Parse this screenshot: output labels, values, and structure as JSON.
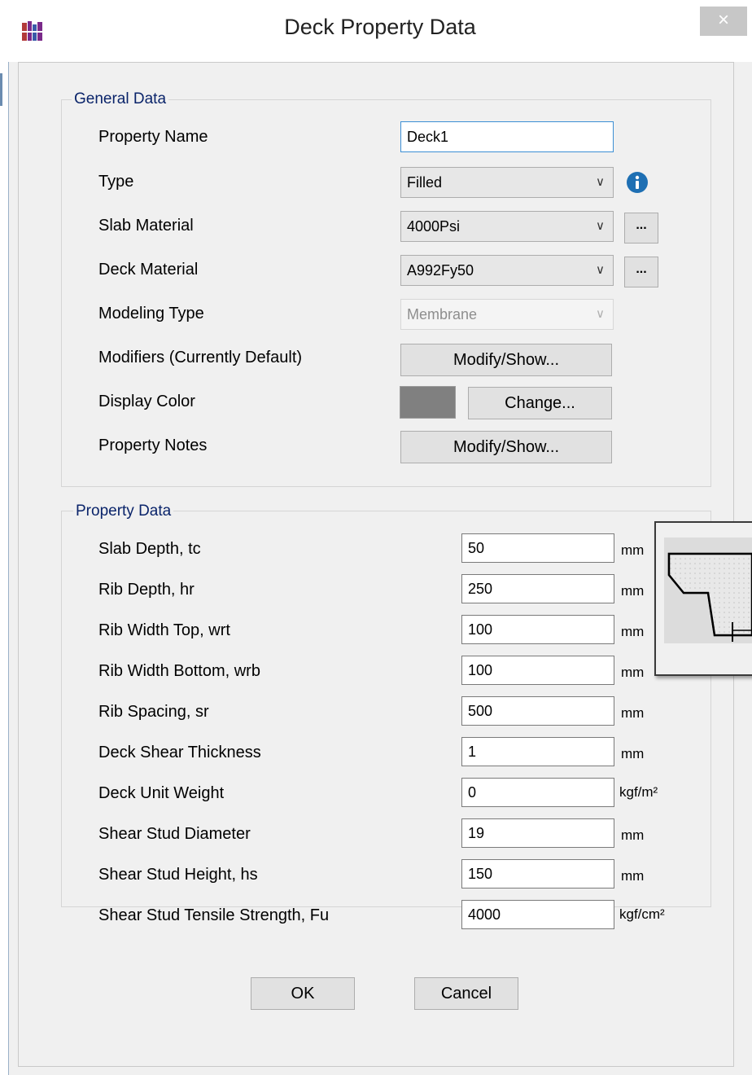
{
  "window": {
    "title": "Deck Property Data",
    "close": "×"
  },
  "general": {
    "legend": "General Data",
    "property_name": {
      "label": "Property Name",
      "value": "Deck1"
    },
    "type": {
      "label": "Type",
      "value": "Filled"
    },
    "slab_material": {
      "label": "Slab Material",
      "value": "4000Psi",
      "browse": "..."
    },
    "deck_material": {
      "label": "Deck Material",
      "value": "A992Fy50",
      "browse": "..."
    },
    "modeling_type": {
      "label": "Modeling Type",
      "value": "Membrane"
    },
    "modifiers": {
      "label": "Modifiers (Currently Default)",
      "button": "Modify/Show..."
    },
    "display_color": {
      "label": "Display Color",
      "button": "Change...",
      "swatch": "#808080"
    },
    "notes": {
      "label": "Property Notes",
      "button": "Modify/Show..."
    }
  },
  "property": {
    "legend": "Property Data",
    "rows": [
      {
        "label": "Slab Depth, tc",
        "value": "50",
        "unit": "mm"
      },
      {
        "label": "Rib Depth, hr",
        "value": "250",
        "unit": "mm"
      },
      {
        "label": "Rib Width Top, wrt",
        "value": "100",
        "unit": "mm"
      },
      {
        "label": "Rib Width Bottom, wrb",
        "value": "100",
        "unit": "mm"
      },
      {
        "label": "Rib Spacing, sr",
        "value": "500",
        "unit": "mm"
      },
      {
        "label": "Deck Shear Thickness",
        "value": "1",
        "unit": "mm"
      },
      {
        "label": "Deck Unit Weight",
        "value": "0",
        "unit": "kgf/m²"
      },
      {
        "label": "Shear Stud Diameter",
        "value": "19",
        "unit": "mm"
      },
      {
        "label": "Shear Stud Height, hs",
        "value": "150",
        "unit": "mm"
      },
      {
        "label": "Shear Stud Tensile Strength, Fu",
        "value": "4000",
        "unit": "kgf/cm²"
      }
    ]
  },
  "buttons": {
    "ok": "OK",
    "cancel": "Cancel"
  },
  "icons": {
    "app": "app-logo-icon",
    "info": "info-icon",
    "close": "close-icon",
    "dropdown": "chevron-down-icon",
    "preview": "deck-section-preview-icon"
  },
  "colors": {
    "legend_text": "#0a246a",
    "info_icon": "#1e6fb3",
    "focus_border": "#3c8fd4"
  }
}
